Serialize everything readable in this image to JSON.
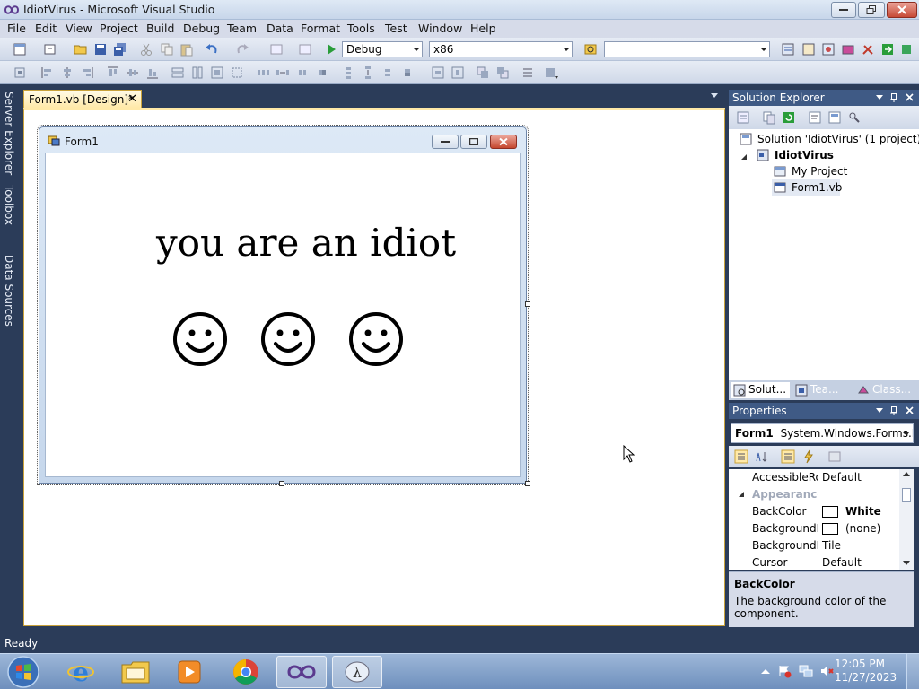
{
  "window": {
    "title": "IdiotVirus - Microsoft Visual Studio"
  },
  "menu": [
    "File",
    "Edit",
    "View",
    "Project",
    "Build",
    "Debug",
    "Team",
    "Data",
    "Format",
    "Tools",
    "Test",
    "Window",
    "Help"
  ],
  "toolbar": {
    "config": "Debug",
    "platform": "x86",
    "search": ""
  },
  "side_tabs": [
    "Server Explorer",
    "Toolbox",
    "Data Sources"
  ],
  "document_tab": {
    "label": "Form1.vb [Design]*",
    "close": "✕"
  },
  "form": {
    "title": "Form1",
    "label_text": "you are an idiot",
    "smileys": [
      "☺",
      "☺",
      "☺"
    ]
  },
  "solution_explorer": {
    "title": "Solution Explorer",
    "tree": [
      "Solution 'IdiotVirus' (1 project)",
      "IdiotVirus",
      "My Project",
      "Form1.vb"
    ],
    "tabs": [
      "Solut...",
      "Tea...",
      "Class..."
    ]
  },
  "properties": {
    "title": "Properties",
    "object": "Form1",
    "object_type": "System.Windows.Forms.Fo",
    "rows": [
      {
        "name": "AccessibleRol",
        "value": "Default",
        "kind": "plain"
      },
      {
        "name": "Appearance",
        "value": "",
        "kind": "category"
      },
      {
        "name": "BackColor",
        "value": "White",
        "kind": "color"
      },
      {
        "name": "BackgroundIr",
        "value": "(none)",
        "kind": "color"
      },
      {
        "name": "BackgroundIr",
        "value": "Tile",
        "kind": "plain"
      },
      {
        "name": "Cursor",
        "value": "Default",
        "kind": "plain"
      }
    ],
    "desc_title": "BackColor",
    "desc_text": "The background color of the component."
  },
  "status": "Ready",
  "clock": {
    "time": "12:05 PM",
    "date": "11/27/2023"
  },
  "colors": {
    "accent": "#3f5a85",
    "chrome": "#2b3c59",
    "doc_tab": "#ffe9a8"
  }
}
